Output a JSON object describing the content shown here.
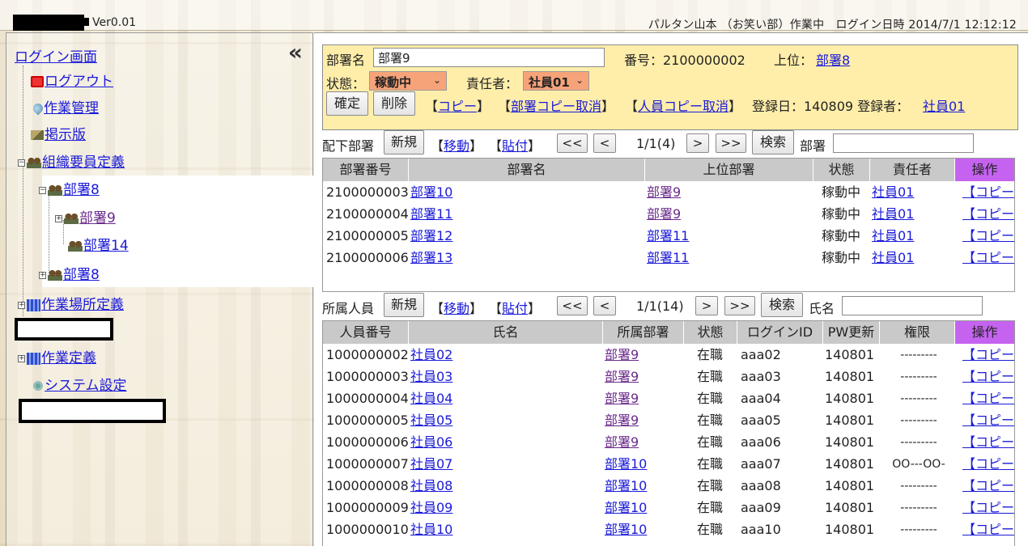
{
  "header": {
    "version": "Ver0.01",
    "user_info": "パルタン山本 （お笑い部）作業中　ログイン日時 2014/7/1 12:12:12"
  },
  "sidebar": {
    "collapse_icon": "«",
    "login_link": "ログイン画面",
    "items": {
      "logout": "ログアウト",
      "work_manage": "作業管理",
      "board": "掲示版",
      "org_def": "組織要員定義",
      "dept8": "部署8",
      "dept9": "部署9",
      "dept14": "部署14",
      "dept8b": "部署8",
      "workplace_def": "作業場所定義",
      "work_def": "作業定義",
      "system_settings": "システム設定"
    },
    "expander_minus": "−",
    "expander_plus": "+"
  },
  "form": {
    "dept_name_label": "部署名",
    "dept_name_value": "部署9",
    "number_label": "番号：2100000002",
    "parent_label": "上位：",
    "parent_value": "部署8",
    "status_label": "状態：",
    "status_value": "稼動中",
    "manager_label": "責任者：",
    "manager_value": "社員01",
    "confirm_btn": "確定",
    "delete_btn": "削除",
    "copy_link": "コピー",
    "dept_copy_cancel": "部署コピー取消",
    "staff_copy_cancel": "人員コピー取消",
    "reg_date": "登録日：140809 登録者：",
    "registrant": "社員01",
    "chevron_icon": "chevron-down-icon"
  },
  "sub_depts": {
    "label": "配下部署",
    "new_btn": "新規",
    "move_link": "移動",
    "paste_link": "貼付",
    "first_btn": "<<",
    "prev_btn": "<",
    "page_info": "1/1(4)",
    "next_btn": ">",
    "last_btn": ">>",
    "search_btn": "検索",
    "search_label": "部署",
    "headers": [
      "部署番号",
      "部署名",
      "上位部署",
      "状態",
      "責任者",
      "操作"
    ],
    "rows": [
      {
        "id": "2100000003",
        "name": "部署10",
        "parent": "部署9",
        "status": "稼動中",
        "manager": "社員01",
        "op": "【コピー】"
      },
      {
        "id": "2100000004",
        "name": "部署11",
        "parent": "部署9",
        "status": "稼動中",
        "manager": "社員01",
        "op": "【コピー】"
      },
      {
        "id": "2100000005",
        "name": "部署12",
        "parent": "部署11",
        "status": "稼動中",
        "manager": "社員01",
        "op": "【コピー】"
      },
      {
        "id": "2100000006",
        "name": "部署13",
        "parent": "部署11",
        "status": "稼動中",
        "manager": "社員01",
        "op": "【コピー】"
      }
    ]
  },
  "staff": {
    "label": "所属人員",
    "new_btn": "新規",
    "move_link": "移動",
    "paste_link": "貼付",
    "first_btn": "<<",
    "prev_btn": "<",
    "page_info": "1/1(14)",
    "next_btn": ">",
    "last_btn": ">>",
    "search_btn": "検索",
    "search_label": "氏名",
    "headers": [
      "人員番号",
      "氏名",
      "所属部署",
      "状態",
      "ログインID",
      "PW更新",
      "権限",
      "操作"
    ],
    "auth_dashes": "---------",
    "auth_special": "OO---OO-",
    "rows": [
      {
        "id": "1000000002",
        "name": "社員02",
        "dept": "部署9",
        "status": "在職",
        "login": "aaa02",
        "pw": "140801",
        "op": "【コピー】"
      },
      {
        "id": "1000000003",
        "name": "社員03",
        "dept": "部署9",
        "status": "在職",
        "login": "aaa03",
        "pw": "140801",
        "op": "【コピー】"
      },
      {
        "id": "1000000004",
        "name": "社員04",
        "dept": "部署9",
        "status": "在職",
        "login": "aaa04",
        "pw": "140801",
        "op": "【コピー】"
      },
      {
        "id": "1000000005",
        "name": "社員05",
        "dept": "部署9",
        "status": "在職",
        "login": "aaa05",
        "pw": "140801",
        "op": "【コピー】"
      },
      {
        "id": "1000000006",
        "name": "社員06",
        "dept": "部署9",
        "status": "在職",
        "login": "aaa06",
        "pw": "140801",
        "op": "【コピー】"
      },
      {
        "id": "1000000007",
        "name": "社員07",
        "dept": "部署10",
        "status": "在職",
        "login": "aaa07",
        "pw": "140801",
        "op": "【コピー】"
      },
      {
        "id": "1000000008",
        "name": "社員08",
        "dept": "部署10",
        "status": "在職",
        "login": "aaa08",
        "pw": "140801",
        "op": "【コピー】"
      },
      {
        "id": "1000000009",
        "name": "社員09",
        "dept": "部署10",
        "status": "在職",
        "login": "aaa09",
        "pw": "140801",
        "op": "【コピー】"
      },
      {
        "id": "1000000010",
        "name": "社員10",
        "dept": "部署10",
        "status": "在職",
        "login": "aaa10",
        "pw": "140801",
        "op": "【コピー】"
      }
    ]
  }
}
